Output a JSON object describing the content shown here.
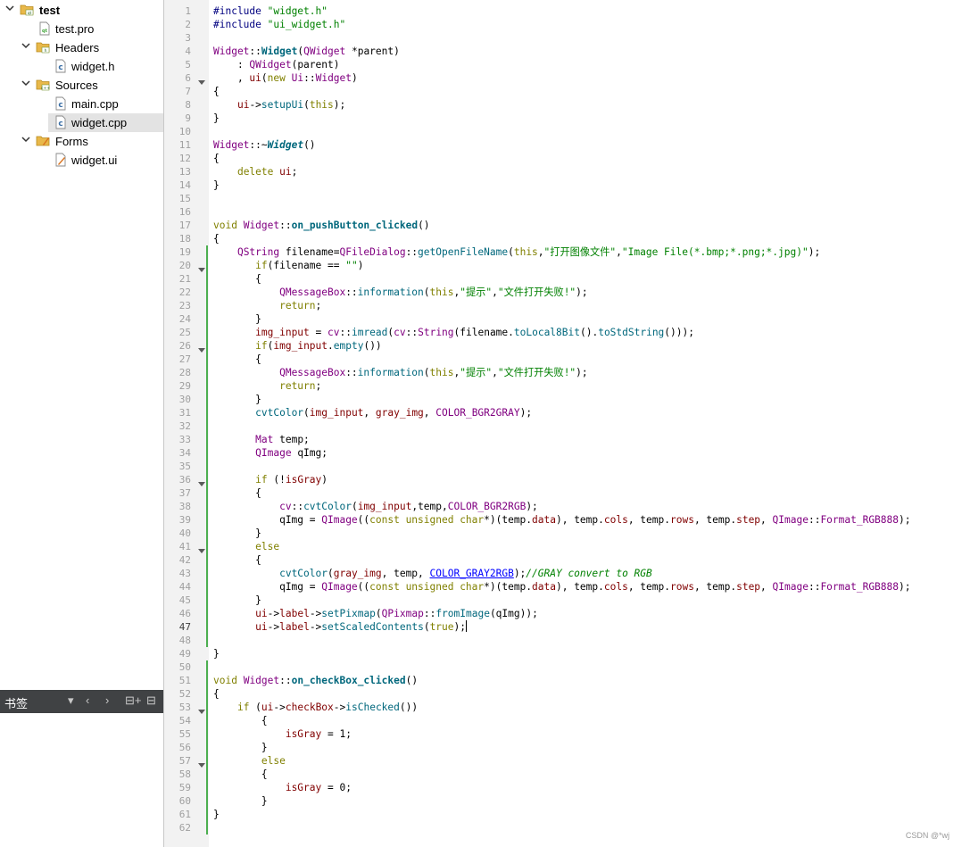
{
  "sidebar": {
    "tree": [
      {
        "label": "test",
        "bold": true,
        "icon": "qt-project-icon",
        "arrow": "down"
      },
      {
        "label": "test.pro",
        "icon": "pro-file-icon"
      },
      {
        "label": "Headers",
        "icon": "headers-folder-icon",
        "arrow": "down"
      },
      {
        "label": "widget.h",
        "icon": "header-file-icon"
      },
      {
        "label": "Sources",
        "icon": "sources-folder-icon",
        "arrow": "down"
      },
      {
        "label": "main.cpp",
        "icon": "cpp-file-icon"
      },
      {
        "label": "widget.cpp",
        "icon": "cpp-file-icon",
        "selected": true
      },
      {
        "label": "Forms",
        "icon": "forms-folder-icon",
        "arrow": "down"
      },
      {
        "label": "widget.ui",
        "icon": "ui-file-icon"
      }
    ],
    "bookmarks": {
      "title": "书签",
      "icons": [
        "dropdown-arrow-icon",
        "back-arrow-icon",
        "forward-arrow-icon",
        "split-icon",
        "close-pane-icon"
      ]
    }
  },
  "editor": {
    "current_line": 47,
    "lines": [
      [
        [
          "pp",
          "#include "
        ],
        [
          "str",
          "\"widget.h\""
        ]
      ],
      [
        [
          "pp",
          "#include "
        ],
        [
          "str",
          "\"ui_widget.h\""
        ]
      ],
      [],
      [
        [
          "cls",
          "Widget"
        ],
        [
          "",
          "::"
        ],
        [
          "fnb",
          "Widget"
        ],
        [
          "",
          "("
        ],
        [
          "cls",
          "QWidget"
        ],
        [
          "",
          " *parent)"
        ]
      ],
      [
        [
          "",
          "    : "
        ],
        [
          "cls",
          "QWidget"
        ],
        [
          "",
          "(parent)"
        ]
      ],
      [
        [
          "",
          "    , "
        ],
        [
          "fld",
          "ui"
        ],
        [
          "",
          "("
        ],
        [
          "kw",
          "new"
        ],
        [
          "",
          " "
        ],
        [
          "cls",
          "Ui"
        ],
        [
          "",
          "::"
        ],
        [
          "cls",
          "Widget"
        ],
        [
          "",
          ")"
        ]
      ],
      [
        [
          "",
          "{"
        ]
      ],
      [
        [
          "",
          "    "
        ],
        [
          "fld",
          "ui"
        ],
        [
          "",
          "->"
        ],
        [
          "fn",
          "setupUi"
        ],
        [
          "",
          "("
        ],
        [
          "kw",
          "this"
        ],
        [
          "",
          ");"
        ]
      ],
      [
        [
          "",
          "}"
        ]
      ],
      [],
      [
        [
          "cls",
          "Widget"
        ],
        [
          "",
          "::~"
        ],
        [
          "fni",
          "Widget"
        ],
        [
          "",
          "()"
        ]
      ],
      [
        [
          "",
          "{"
        ]
      ],
      [
        [
          "",
          "    "
        ],
        [
          "kw",
          "delete"
        ],
        [
          "",
          " "
        ],
        [
          "fld",
          "ui"
        ],
        [
          "",
          ";"
        ]
      ],
      [
        [
          "",
          "}"
        ]
      ],
      [],
      [],
      [
        [
          "kw",
          "void"
        ],
        [
          "",
          " "
        ],
        [
          "cls",
          "Widget"
        ],
        [
          "",
          "::"
        ],
        [
          "fnb",
          "on_pushButton_clicked"
        ],
        [
          "",
          "()"
        ]
      ],
      [
        [
          "",
          "{"
        ]
      ],
      [
        [
          "",
          "    "
        ],
        [
          "cls",
          "QString"
        ],
        [
          "",
          " filename="
        ],
        [
          "cls",
          "QFileDialog"
        ],
        [
          "",
          "::"
        ],
        [
          "fn",
          "getOpenFileName"
        ],
        [
          "",
          "("
        ],
        [
          "kw",
          "this"
        ],
        [
          "",
          ","
        ],
        [
          "str",
          "\"打开图像文件\""
        ],
        [
          "",
          ","
        ],
        [
          "str",
          "\"Image File(*.bmp;*.png;*.jpg)\""
        ],
        [
          "",
          ");"
        ]
      ],
      [
        [
          "",
          "       "
        ],
        [
          "kw",
          "if"
        ],
        [
          "",
          "(filename == "
        ],
        [
          "str",
          "\"\""
        ],
        [
          "",
          ")"
        ]
      ],
      [
        [
          "",
          "       {"
        ]
      ],
      [
        [
          "",
          "           "
        ],
        [
          "cls",
          "QMessageBox"
        ],
        [
          "",
          "::"
        ],
        [
          "fn",
          "information"
        ],
        [
          "",
          "("
        ],
        [
          "kw",
          "this"
        ],
        [
          "",
          ","
        ],
        [
          "str",
          "\"提示\""
        ],
        [
          "",
          ","
        ],
        [
          "str",
          "\"文件打开失败!\""
        ],
        [
          "",
          ");"
        ]
      ],
      [
        [
          "",
          "           "
        ],
        [
          "kw",
          "return"
        ],
        [
          "",
          ";"
        ]
      ],
      [
        [
          "",
          "       }"
        ]
      ],
      [
        [
          "",
          "       "
        ],
        [
          "fld",
          "img_input"
        ],
        [
          "",
          " = "
        ],
        [
          "cls",
          "cv"
        ],
        [
          "",
          "::"
        ],
        [
          "fn",
          "imread"
        ],
        [
          "",
          "("
        ],
        [
          "cls",
          "cv"
        ],
        [
          "",
          "::"
        ],
        [
          "cls",
          "String"
        ],
        [
          "",
          "(filename."
        ],
        [
          "fn",
          "toLocal8Bit"
        ],
        [
          "",
          "()."
        ],
        [
          "fn",
          "toStdString"
        ],
        [
          "",
          "()));"
        ]
      ],
      [
        [
          "",
          "       "
        ],
        [
          "kw",
          "if"
        ],
        [
          "",
          "("
        ],
        [
          "fld",
          "img_input"
        ],
        [
          "",
          "."
        ],
        [
          "fn",
          "empty"
        ],
        [
          "",
          "())"
        ]
      ],
      [
        [
          "",
          "       {"
        ]
      ],
      [
        [
          "",
          "           "
        ],
        [
          "cls",
          "QMessageBox"
        ],
        [
          "",
          "::"
        ],
        [
          "fn",
          "information"
        ],
        [
          "",
          "("
        ],
        [
          "kw",
          "this"
        ],
        [
          "",
          ","
        ],
        [
          "str",
          "\"提示\""
        ],
        [
          "",
          ","
        ],
        [
          "str",
          "\"文件打开失败!\""
        ],
        [
          "",
          ");"
        ]
      ],
      [
        [
          "",
          "           "
        ],
        [
          "kw",
          "return"
        ],
        [
          "",
          ";"
        ]
      ],
      [
        [
          "",
          "       }"
        ]
      ],
      [
        [
          "",
          "       "
        ],
        [
          "fn",
          "cvtColor"
        ],
        [
          "",
          "("
        ],
        [
          "fld",
          "img_input"
        ],
        [
          "",
          ", "
        ],
        [
          "fld",
          "gray_img"
        ],
        [
          "",
          ", "
        ],
        [
          "enum",
          "COLOR_BGR2GRAY"
        ],
        [
          "",
          ");"
        ]
      ],
      [],
      [
        [
          "",
          "       "
        ],
        [
          "cls",
          "Mat"
        ],
        [
          "",
          " temp;"
        ]
      ],
      [
        [
          "",
          "       "
        ],
        [
          "cls",
          "QImage"
        ],
        [
          "",
          " qImg;"
        ]
      ],
      [],
      [
        [
          "",
          "       "
        ],
        [
          "kw",
          "if"
        ],
        [
          "",
          " (!"
        ],
        [
          "fld",
          "isGray"
        ],
        [
          "",
          ")"
        ]
      ],
      [
        [
          "",
          "       {"
        ]
      ],
      [
        [
          "",
          "           "
        ],
        [
          "cls",
          "cv"
        ],
        [
          "",
          "::"
        ],
        [
          "fn",
          "cvtColor"
        ],
        [
          "",
          "("
        ],
        [
          "fld",
          "img_input"
        ],
        [
          "",
          ",temp,"
        ],
        [
          "enum",
          "COLOR_BGR2RGB"
        ],
        [
          "",
          ");"
        ]
      ],
      [
        [
          "",
          "           qImg = "
        ],
        [
          "cls",
          "QImage"
        ],
        [
          "",
          "(("
        ],
        [
          "kw",
          "const unsigned char"
        ],
        [
          "",
          "*)(temp."
        ],
        [
          "fld",
          "data"
        ],
        [
          "",
          "), temp."
        ],
        [
          "fld",
          "cols"
        ],
        [
          "",
          ", temp."
        ],
        [
          "fld",
          "rows"
        ],
        [
          "",
          ", temp."
        ],
        [
          "fld",
          "step"
        ],
        [
          "",
          ", "
        ],
        [
          "cls",
          "QImage"
        ],
        [
          "",
          "::"
        ],
        [
          "enum",
          "Format_RGB888"
        ],
        [
          "",
          ");"
        ]
      ],
      [
        [
          "",
          "       }"
        ]
      ],
      [
        [
          "",
          "       "
        ],
        [
          "kw",
          "else"
        ]
      ],
      [
        [
          "",
          "       {"
        ]
      ],
      [
        [
          "",
          "           "
        ],
        [
          "fn",
          "cvtColor"
        ],
        [
          "",
          "("
        ],
        [
          "fld",
          "gray_img"
        ],
        [
          "",
          ", temp, "
        ],
        [
          "link",
          "COLOR_GRAY2RGB"
        ],
        [
          "",
          ");"
        ],
        [
          "cmt",
          "//GRAY convert to RGB"
        ]
      ],
      [
        [
          "",
          "           qImg = "
        ],
        [
          "cls",
          "QImage"
        ],
        [
          "",
          "(("
        ],
        [
          "kw",
          "const unsigned char"
        ],
        [
          "",
          "*)(temp."
        ],
        [
          "fld",
          "data"
        ],
        [
          "",
          "), temp."
        ],
        [
          "fld",
          "cols"
        ],
        [
          "",
          ", temp."
        ],
        [
          "fld",
          "rows"
        ],
        [
          "",
          ", temp."
        ],
        [
          "fld",
          "step"
        ],
        [
          "",
          ", "
        ],
        [
          "cls",
          "QImage"
        ],
        [
          "",
          "::"
        ],
        [
          "enum",
          "Format_RGB888"
        ],
        [
          "",
          ");"
        ]
      ],
      [
        [
          "",
          "       }"
        ]
      ],
      [
        [
          "",
          "       "
        ],
        [
          "fld",
          "ui"
        ],
        [
          "",
          "->"
        ],
        [
          "fld",
          "label"
        ],
        [
          "",
          "->"
        ],
        [
          "fn",
          "setPixmap"
        ],
        [
          "",
          "("
        ],
        [
          "cls",
          "QPixmap"
        ],
        [
          "",
          "::"
        ],
        [
          "fn",
          "fromImage"
        ],
        [
          "",
          "(qImg));"
        ]
      ],
      [
        [
          "",
          "       "
        ],
        [
          "fld",
          "ui"
        ],
        [
          "",
          "->"
        ],
        [
          "fld",
          "label"
        ],
        [
          "",
          "->"
        ],
        [
          "fn",
          "setScaledContents"
        ],
        [
          "",
          "("
        ],
        [
          "kw",
          "true"
        ],
        [
          "",
          ");"
        ],
        [
          "cursor",
          ""
        ]
      ],
      [],
      [
        [
          "",
          "}"
        ]
      ],
      [],
      [
        [
          "kw",
          "void"
        ],
        [
          "",
          " "
        ],
        [
          "cls",
          "Widget"
        ],
        [
          "",
          "::"
        ],
        [
          "fnb",
          "on_checkBox_clicked"
        ],
        [
          "",
          "()"
        ]
      ],
      [
        [
          "",
          "{"
        ]
      ],
      [
        [
          "",
          "    "
        ],
        [
          "kw",
          "if"
        ],
        [
          "",
          " ("
        ],
        [
          "fld",
          "ui"
        ],
        [
          "",
          "->"
        ],
        [
          "fld",
          "checkBox"
        ],
        [
          "",
          "->"
        ],
        [
          "fn",
          "isChecked"
        ],
        [
          "",
          "())"
        ]
      ],
      [
        [
          "",
          "        {"
        ]
      ],
      [
        [
          "",
          "            "
        ],
        [
          "fld",
          "isGray"
        ],
        [
          "",
          " = 1;"
        ]
      ],
      [
        [
          "",
          "        }"
        ]
      ],
      [
        [
          "",
          "        "
        ],
        [
          "kw",
          "else"
        ]
      ],
      [
        [
          "",
          "        {"
        ]
      ],
      [
        [
          "",
          "            "
        ],
        [
          "fld",
          "isGray"
        ],
        [
          "",
          " = 0;"
        ]
      ],
      [
        [
          "",
          "        }"
        ]
      ],
      [
        [
          "",
          "}"
        ]
      ],
      []
    ],
    "fold_lines": [
      6,
      20,
      26,
      36,
      41,
      53,
      57
    ],
    "modified_ranges": [
      [
        19,
        48
      ],
      [
        50,
        62
      ]
    ]
  },
  "watermark": "CSDN @*wj"
}
